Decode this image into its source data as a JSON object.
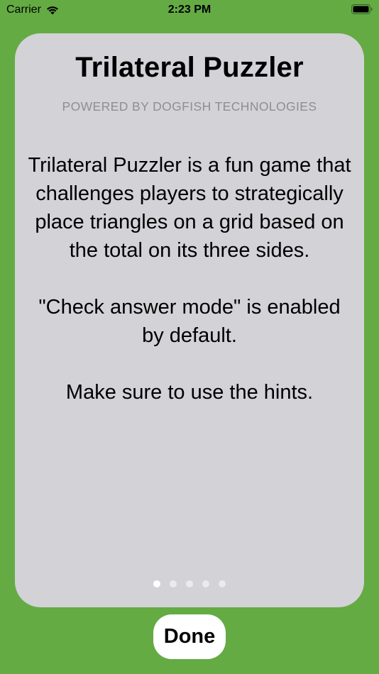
{
  "status_bar": {
    "carrier": "Carrier",
    "time": "2:23 PM"
  },
  "card": {
    "title": "Trilateral Puzzler",
    "subtitle": "POWERED BY DOGFISH TECHNOLOGIES",
    "paragraphs": [
      "Trilateral Puzzler is a fun game that challenges players to strategically place triangles on a grid based on the total on its three sides.",
      "\"Check answer mode\" is enabled by default.",
      "Make sure to use the hints."
    ],
    "page_count": 5,
    "current_page": 1
  },
  "done_label": "Done",
  "colors": {
    "background": "#64ab44",
    "card": "#d2d2d7",
    "subtitle": "#8e8e93",
    "button": "#ffffff"
  }
}
